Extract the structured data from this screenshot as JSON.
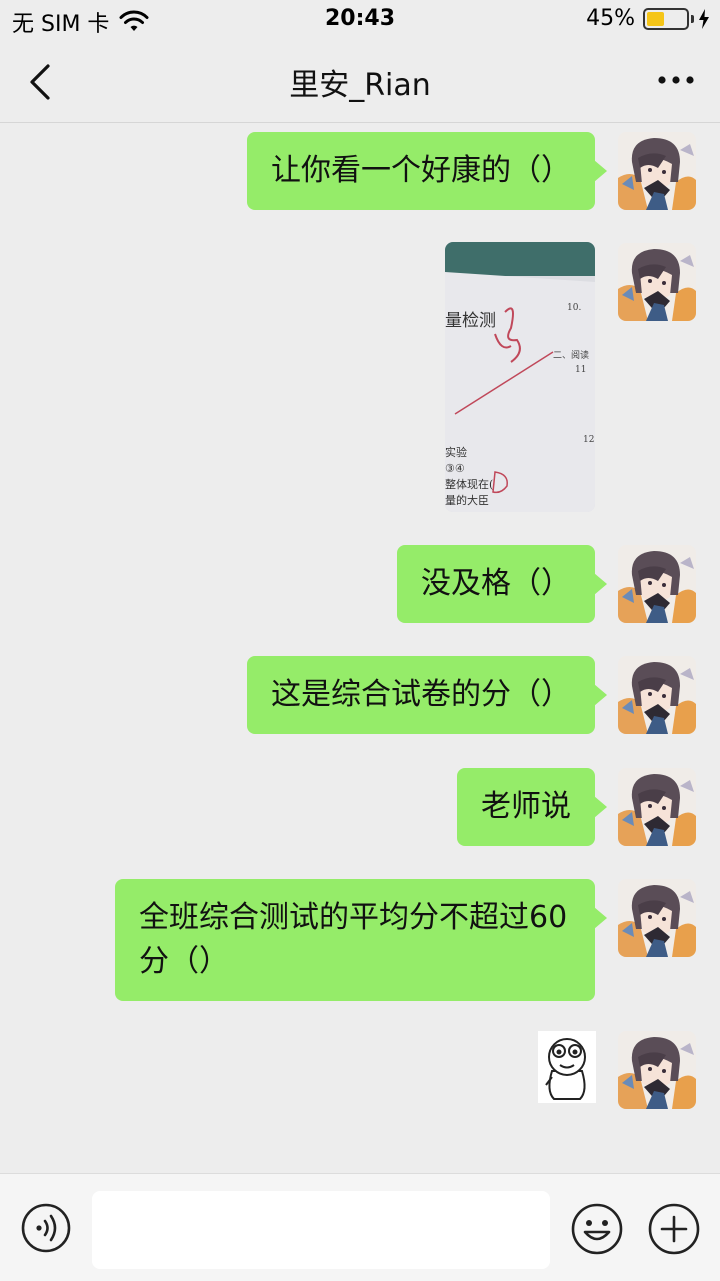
{
  "status_bar": {
    "carrier": "无 SIM 卡",
    "time": "20:43",
    "battery_percent": "45%",
    "battery_level": 0.45,
    "wifi_icon": "wifi-icon",
    "charging_icon": "bolt-icon"
  },
  "nav": {
    "title": "里安_Rian",
    "back_icon": "chevron-left-icon",
    "more_icon": "more-dots-icon"
  },
  "messages": [
    {
      "type": "text",
      "text": "让你看一个好康的（）"
    },
    {
      "type": "image",
      "text": ""
    },
    {
      "type": "text",
      "text": "没及格（）"
    },
    {
      "type": "text",
      "text": "这是综合试卷的分（）"
    },
    {
      "type": "text",
      "text": "老师说"
    },
    {
      "type": "text",
      "text": "全班综合测试的平均分不超过60分（）"
    },
    {
      "type": "sticker",
      "text": ""
    }
  ],
  "input_bar": {
    "voice_icon": "voice-icon",
    "emoji_icon": "emoji-icon",
    "plus_icon": "plus-icon",
    "input_value": ""
  },
  "colors": {
    "bubble": "#95ec69",
    "background": "#ededed",
    "battery": "#f5c518"
  }
}
